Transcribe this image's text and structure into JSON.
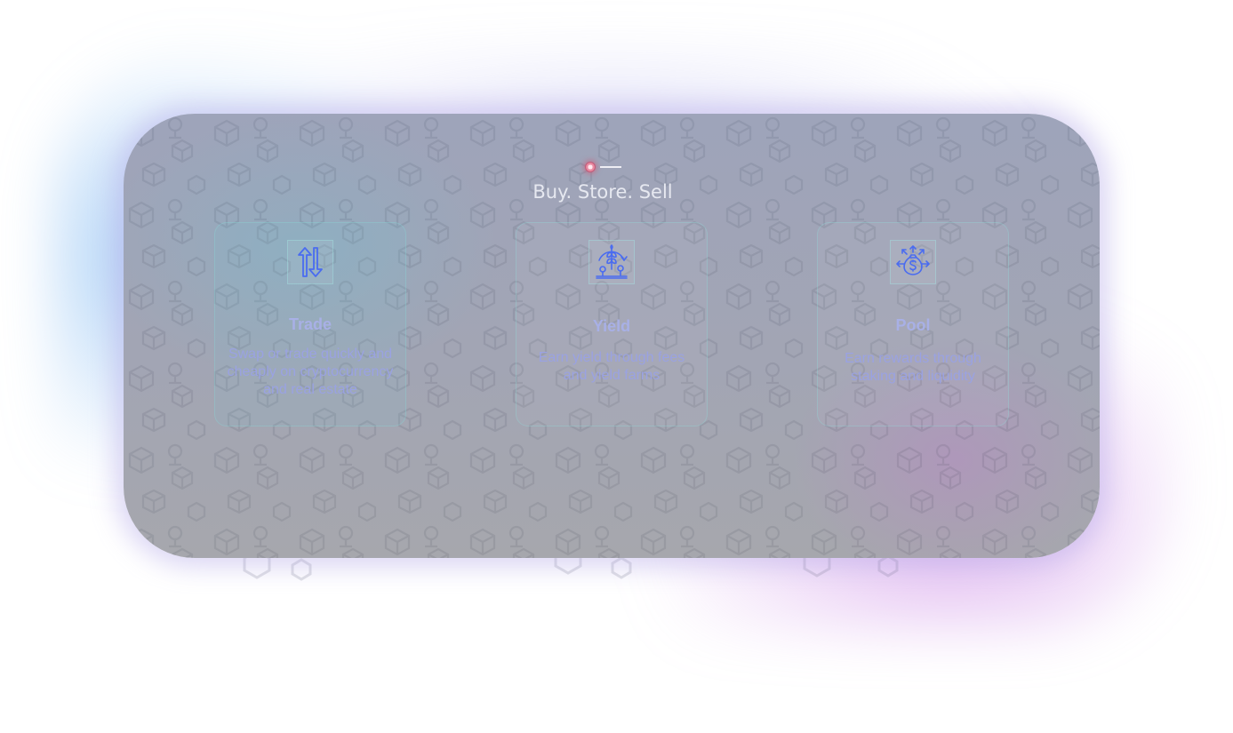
{
  "section": {
    "title": "Buy. Store. Sell"
  },
  "cards": [
    {
      "title": "Trade",
      "description": "Swap or trade quickly and cheaply on cryptocurrency and real estate",
      "icon": "trade-arrows-icon"
    },
    {
      "title": "Yield",
      "description": "Earn yield through fees and yield farms",
      "icon": "yield-farm-icon"
    },
    {
      "title": "Pool",
      "description": "Earn rewards through staking and liquidity",
      "icon": "money-bag-icon"
    }
  ],
  "colors": {
    "icon_blue": "#4a6cf0",
    "indicator_active": "#c25a78",
    "card_text": "#a8b0e6"
  }
}
